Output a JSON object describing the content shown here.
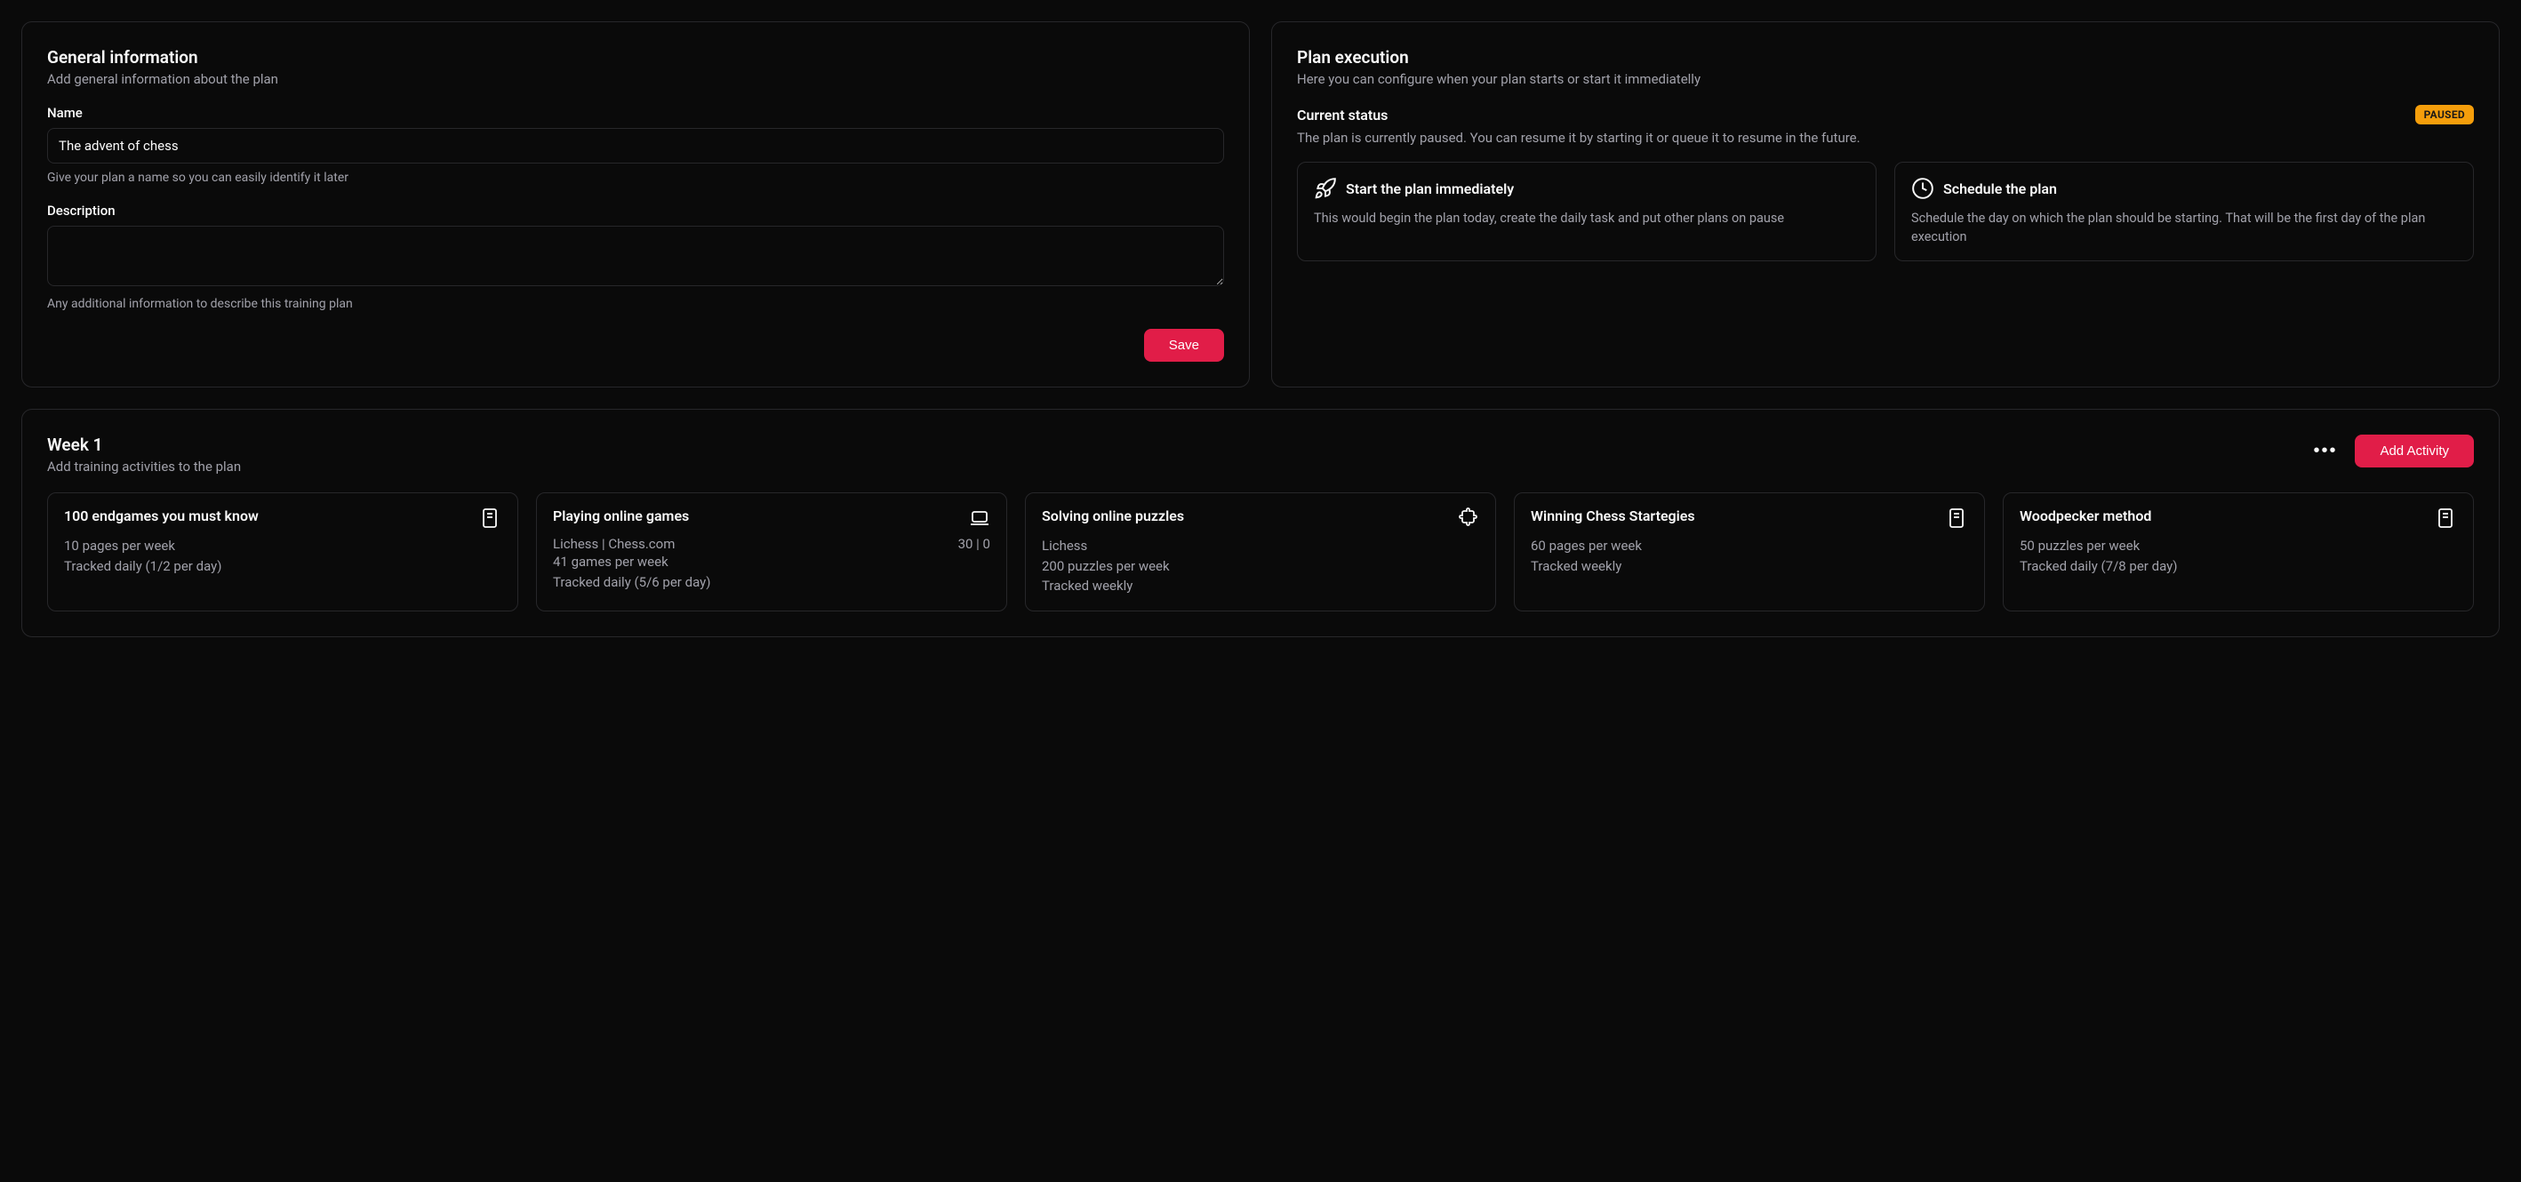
{
  "general": {
    "title": "General information",
    "subtitle": "Add general information about the plan",
    "name_label": "Name",
    "name_value": "The advent of chess",
    "name_hint": "Give your plan a name so you can easily identify it later",
    "desc_label": "Description",
    "desc_value": "",
    "desc_hint": "Any additional information to describe this training plan",
    "save_label": "Save"
  },
  "execution": {
    "title": "Plan execution",
    "subtitle": "Here you can configure when your plan starts or start it immediatelly",
    "status_label": "Current status",
    "status_badge": "PAUSED",
    "status_desc": "The plan is currently paused. You can resume it by starting it or queue it to resume in the future.",
    "options": [
      {
        "title": "Start the plan immediately",
        "desc": "This would begin the plan today, create the daily task and put other plans on pause"
      },
      {
        "title": "Schedule the plan",
        "desc": "Schedule the day on which the plan should be starting. That will be the first day of the plan execution"
      }
    ]
  },
  "week": {
    "title": "Week 1",
    "subtitle": "Add training activities to the plan",
    "add_label": "Add Activity",
    "activities": [
      {
        "title": "100 endgames you must know",
        "sub": "",
        "meta": "",
        "line1": "10 pages per week",
        "line2": "Tracked daily (1/2 per day)"
      },
      {
        "title": "Playing online games",
        "sub": "Lichess | Chess.com",
        "meta": "30 | 0",
        "line1": "41 games per week",
        "line2": "Tracked daily (5/6 per day)"
      },
      {
        "title": "Solving online puzzles",
        "sub": "Lichess",
        "meta": "",
        "line1": "200 puzzles per week",
        "line2": "Tracked weekly"
      },
      {
        "title": "Winning Chess Startegies",
        "sub": "",
        "meta": "",
        "line1": "60 pages per week",
        "line2": "Tracked weekly"
      },
      {
        "title": "Woodpecker method",
        "sub": "",
        "meta": "",
        "line1": "50 puzzles per week",
        "line2": "Tracked daily (7/8 per day)"
      }
    ]
  }
}
